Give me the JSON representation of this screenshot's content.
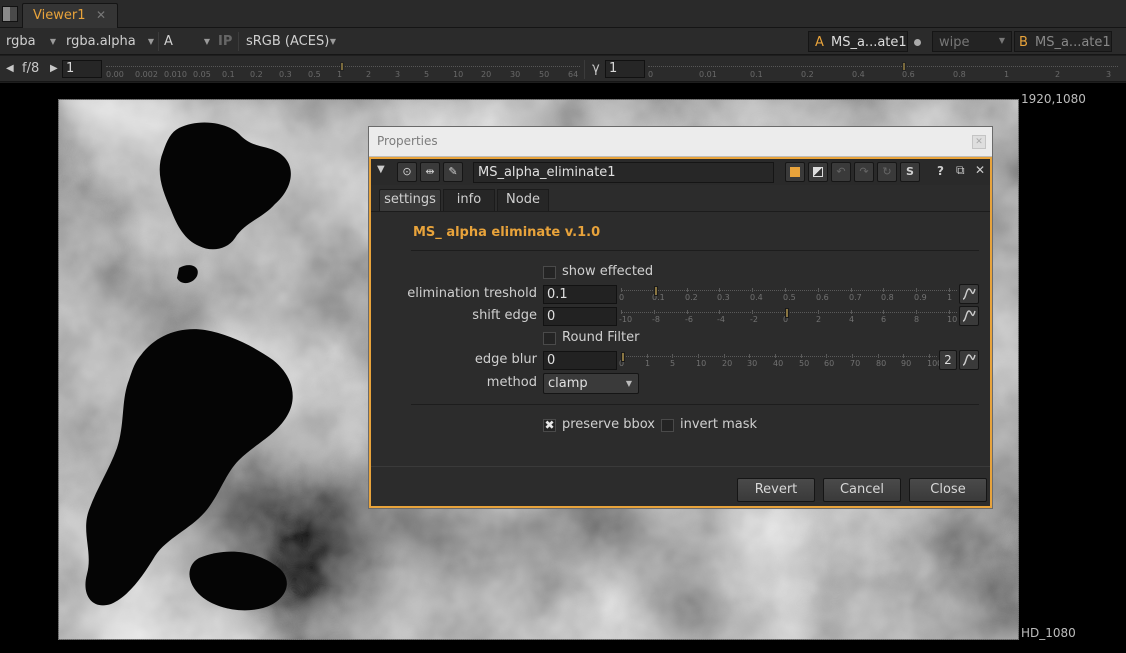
{
  "viewer_tab": {
    "label": "Viewer1",
    "close": "✕"
  },
  "toolbar": {
    "channels": "rgba",
    "alpha_channel": "rgba.alpha",
    "layer": "A",
    "ip_label": "IP",
    "colorspace": "sRGB (ACES)",
    "input_a_letter": "A",
    "input_a_name": "MS_a...ate1",
    "wipe_mode": "wipe",
    "input_b_letter": "B",
    "input_b_name": "MS_a...ate1"
  },
  "range": {
    "fstop": "f/8",
    "gain_value": "1",
    "gamma_symbol": "γ",
    "gamma_value": "1",
    "gain_ticks": [
      "0.00",
      "0.002",
      "0.010",
      "0.05",
      "0.1",
      "0.2",
      "0.3",
      "0.5",
      "1",
      "2",
      "3",
      "5",
      "10",
      "20",
      "30",
      "50",
      "64"
    ],
    "gamma_ticks": [
      "0",
      "0.01",
      "0.1",
      "0.2",
      "0.4",
      "0.6",
      "0.8",
      "1",
      "2",
      "3"
    ]
  },
  "viewer": {
    "resolution_top": "1920,1080",
    "format_label": "HD_1080"
  },
  "properties": {
    "title": "Properties",
    "node_name": "MS_alpha_eliminate1",
    "tabs": [
      "settings",
      "info",
      "Node"
    ],
    "plugin_title": "MS_ alpha eliminate v.1.0",
    "show_effected_label": "show effected",
    "elimination_treshold": {
      "label": "elimination treshold",
      "value": "0.1",
      "ticks": [
        "0",
        "0.1",
        "0.2",
        "0.3",
        "0.4",
        "0.5",
        "0.6",
        "0.7",
        "0.8",
        "0.9",
        "1"
      ]
    },
    "shift_edge": {
      "label": "shift edge",
      "value": "0",
      "ticks": [
        "-10",
        "-8",
        "-6",
        "-4",
        "-2",
        "0",
        "2",
        "4",
        "6",
        "8",
        "10"
      ]
    },
    "round_filter_label": "Round Filter",
    "edge_blur": {
      "label": "edge blur",
      "value": "0",
      "ticks": [
        "0",
        "1",
        "5",
        "10",
        "20",
        "30",
        "40",
        "50",
        "60",
        "70",
        "80",
        "90",
        "100"
      ],
      "extra_button": "2"
    },
    "method": {
      "label": "method",
      "value": "clamp"
    },
    "preserve_bbox_label": "preserve bbox",
    "invert_mask_label": "invert mask",
    "buttons": {
      "revert": "Revert",
      "cancel": "Cancel",
      "close": "Close"
    }
  },
  "colors": {
    "accent": "#e8a33b",
    "panel_bg": "#2c2c2c"
  }
}
